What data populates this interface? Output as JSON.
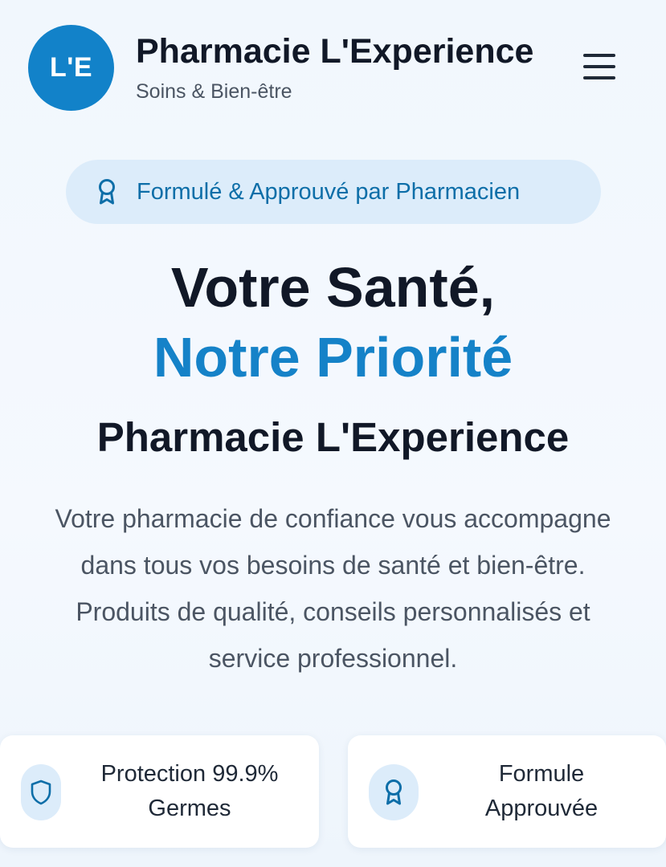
{
  "header": {
    "logo_text": "L'E",
    "brand_name": "Pharmacie L'Experience",
    "tagline": "Soins & Bien-être",
    "menu_icon": "hamburger-menu-icon"
  },
  "badge": {
    "icon": "award-ribbon-icon",
    "text": "Formulé & Approuvé par Pharmacien"
  },
  "hero": {
    "line1": "Votre Santé,",
    "line2": "Notre Priorité",
    "subtitle": "Pharmacie L'Experience",
    "description_lines": [
      "Votre pharmacie de confiance vous accompagne",
      "dans tous vos besoins de santé et bien-être.",
      "Produits de qualité, conseils personnalisés et",
      "service professionnel."
    ]
  },
  "features": [
    {
      "icon": "shield-icon",
      "line1": "Protection 99.9%",
      "line2": "Germes"
    },
    {
      "icon": "award-ribbon-icon",
      "line1": "Formule",
      "line2": "Approuvée"
    }
  ],
  "colors": {
    "primary": "#1282c9",
    "accent_text": "#1582c8",
    "badge_bg": "#dcecfa",
    "badge_text": "#0d6ea8",
    "heading": "#111827",
    "body_text": "#4b5563"
  }
}
